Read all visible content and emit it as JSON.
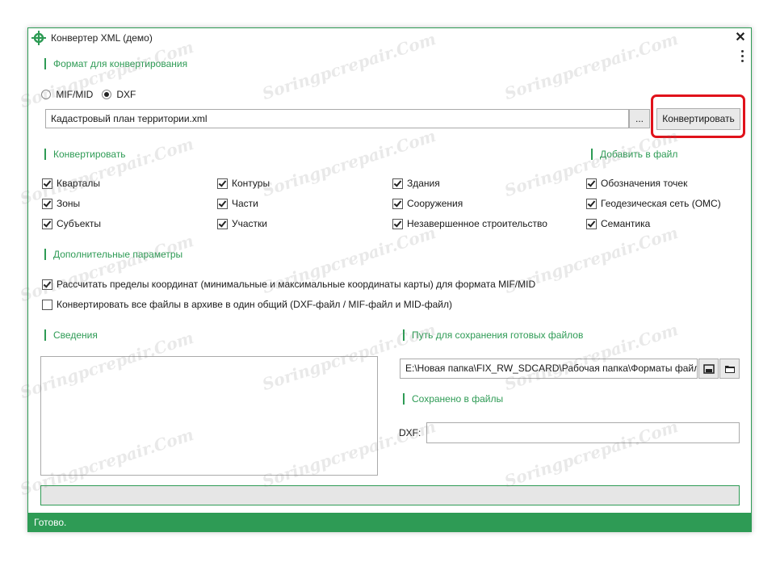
{
  "window": {
    "title": "Конвертер XML (демо)",
    "close_glyph": "✕"
  },
  "format": {
    "title": "Формат для конвертирования",
    "options": [
      {
        "label": "MIF/MID",
        "selected": false
      },
      {
        "label": "DXF",
        "selected": true
      }
    ],
    "file_value": "Кадастровый план территории.xml",
    "browse_label": "...",
    "convert_label": "Конвертировать"
  },
  "convert": {
    "title": "Конвертировать",
    "col1": [
      {
        "label": "Кварталы",
        "checked": true
      },
      {
        "label": "Зоны",
        "checked": true
      },
      {
        "label": "Субъекты",
        "checked": true
      }
    ],
    "col2": [
      {
        "label": "Контуры",
        "checked": true
      },
      {
        "label": "Части",
        "checked": true
      },
      {
        "label": "Участки",
        "checked": true
      }
    ],
    "col3": [
      {
        "label": "Здания",
        "checked": true
      },
      {
        "label": "Сооружения",
        "checked": true
      },
      {
        "label": "Незавершенное строительство",
        "checked": true
      }
    ]
  },
  "add_to_file": {
    "title": "Добавить в файл",
    "items": [
      {
        "label": "Обозначения точек",
        "checked": true
      },
      {
        "label": "Геодезическая сеть (ОМС)",
        "checked": true
      },
      {
        "label": "Семантика",
        "checked": true
      }
    ]
  },
  "extra": {
    "title": "Дополнительные параметры",
    "items": [
      {
        "label": "Рассчитать пределы координат (минимальные и максимальные координаты карты) для формата MIF/MID",
        "checked": true
      },
      {
        "label": "Конвертировать все файлы в архиве в один общий (DXF-файл / MIF-файл и MID-файл)",
        "checked": false
      }
    ]
  },
  "info": {
    "title": "Сведения",
    "text": ""
  },
  "save_path": {
    "title": "Путь для сохранения готовых файлов",
    "value": "E:\\Новая папка\\FIX_RW_SDCARD\\Рабочая папка\\Форматы файло"
  },
  "saved": {
    "title": "Сохранено в файлы",
    "dxf_label": "DXF:",
    "dxf_value": ""
  },
  "status": {
    "text": "Готово."
  },
  "watermark_text": "Soringpcrepair.Com",
  "colors": {
    "accent": "#2e9b55",
    "highlight": "#e0121b"
  }
}
